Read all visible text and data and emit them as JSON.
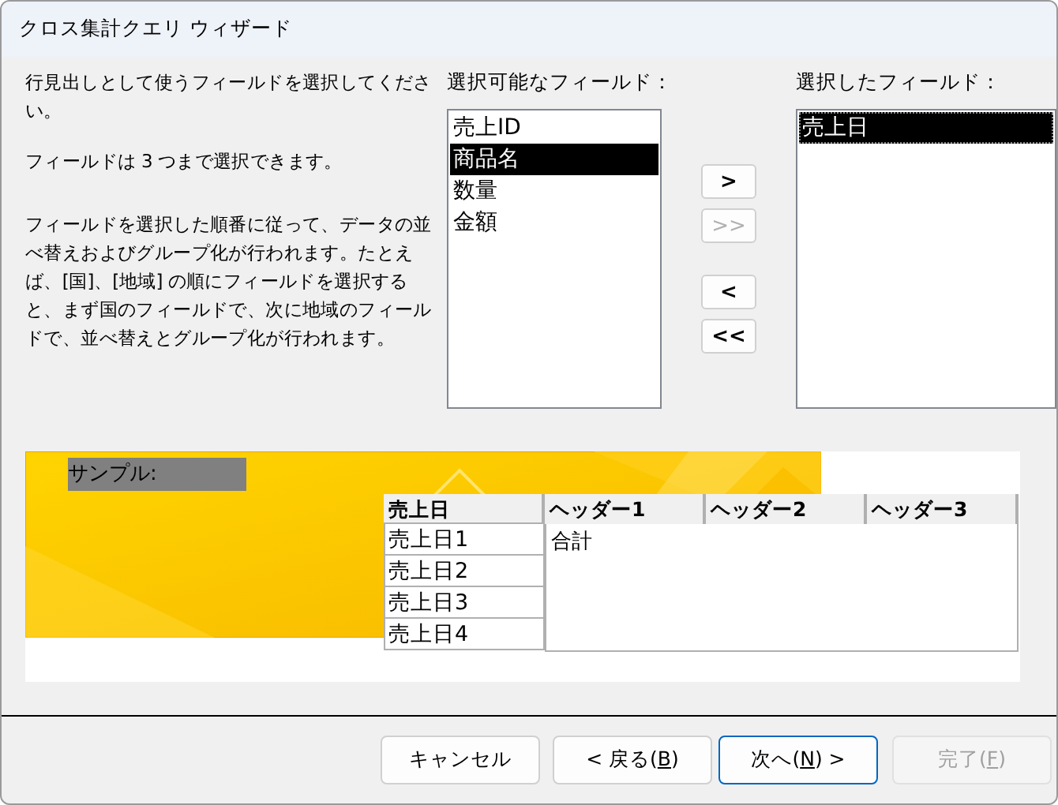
{
  "window": {
    "title": "クロス集計クエリ ウィザード"
  },
  "instructions": [
    "行見出しとして使うフィールドを選択してください。",
    "フィールドは 3 つまで選択できます。",
    "フィールドを選択した順番に従って、データの並べ替えおよびグループ化が行われます。たとえば、[国]、[地域] の順にフィールドを選択すると、まず国のフィールドで、次に地域のフィールドで、並べ替えとグループ化が行われます。"
  ],
  "available": {
    "label": "選択可能なフィールド：",
    "items": [
      {
        "text": "売上ID",
        "selected": false
      },
      {
        "text": "商品名",
        "selected": true
      },
      {
        "text": "数量",
        "selected": false
      },
      {
        "text": "金額",
        "selected": false
      }
    ]
  },
  "move_buttons": [
    {
      "text": ">",
      "disabled": false
    },
    {
      "text": ">>",
      "disabled": true
    },
    {
      "text": "<",
      "disabled": false
    },
    {
      "text": "<<",
      "disabled": false
    }
  ],
  "chosen": {
    "label": "選択したフィールド：",
    "items": [
      {
        "text": "売上日",
        "selected": true
      }
    ]
  },
  "sample": {
    "label": "サンプル:",
    "row_header": "売上日",
    "column_headers": [
      "ヘッダー1",
      "ヘッダー2",
      "ヘッダー3"
    ],
    "rows": [
      "売上日1",
      "売上日2",
      "売上日3",
      "売上日4"
    ],
    "value": "合計"
  },
  "buttons": [
    {
      "before": "キャンセル",
      "disabled": false,
      "default": false
    },
    {
      "before": "< 戻る(",
      "key": "B",
      "after": ")",
      "disabled": false,
      "default": false
    },
    {
      "before": "次へ(",
      "key": "N",
      "after": ") >",
      "disabled": false,
      "default": true
    },
    {
      "before": "完了(",
      "key": "F",
      "after": ")",
      "disabled": true,
      "default": false
    }
  ]
}
